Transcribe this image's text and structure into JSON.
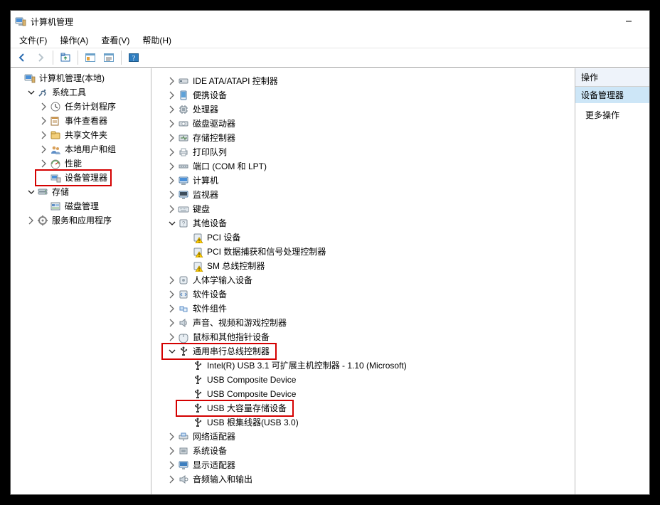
{
  "title": "计算机管理",
  "menus": {
    "file": "文件(F)",
    "action": "操作(A)",
    "view": "查看(V)",
    "help": "帮助(H)"
  },
  "right": {
    "header": "操作",
    "selected": "设备管理器",
    "more": "更多操作"
  },
  "left_tree": [
    {
      "depth": 0,
      "exp": "none",
      "icon": "mmc",
      "label": "计算机管理(本地)"
    },
    {
      "depth": 1,
      "exp": "open",
      "icon": "tools",
      "label": "系统工具"
    },
    {
      "depth": 2,
      "exp": "closed",
      "icon": "sched",
      "label": "任务计划程序"
    },
    {
      "depth": 2,
      "exp": "closed",
      "icon": "eventvwr",
      "label": "事件查看器"
    },
    {
      "depth": 2,
      "exp": "closed",
      "icon": "shares",
      "label": "共享文件夹"
    },
    {
      "depth": 2,
      "exp": "closed",
      "icon": "users",
      "label": "本地用户和组"
    },
    {
      "depth": 2,
      "exp": "closed",
      "icon": "perf",
      "label": "性能"
    },
    {
      "depth": 2,
      "exp": "none",
      "icon": "devmgr",
      "label": "设备管理器",
      "highlight": true
    },
    {
      "depth": 1,
      "exp": "open",
      "icon": "storage",
      "label": "存储"
    },
    {
      "depth": 2,
      "exp": "none",
      "icon": "diskmgr",
      "label": "磁盘管理"
    },
    {
      "depth": 1,
      "exp": "closed",
      "icon": "services",
      "label": "服务和应用程序"
    }
  ],
  "mid_tree": [
    {
      "depth": 0,
      "exp": "closed",
      "icon": "ide",
      "label": "IDE ATA/ATAPI 控制器"
    },
    {
      "depth": 0,
      "exp": "closed",
      "icon": "portable",
      "label": "便携设备"
    },
    {
      "depth": 0,
      "exp": "closed",
      "icon": "cpu",
      "label": "处理器"
    },
    {
      "depth": 0,
      "exp": "closed",
      "icon": "optical",
      "label": "磁盘驱动器"
    },
    {
      "depth": 0,
      "exp": "closed",
      "icon": "storctl",
      "label": "存储控制器"
    },
    {
      "depth": 0,
      "exp": "closed",
      "icon": "printer",
      "label": "打印队列"
    },
    {
      "depth": 0,
      "exp": "closed",
      "icon": "ports",
      "label": "端口 (COM 和 LPT)"
    },
    {
      "depth": 0,
      "exp": "closed",
      "icon": "computer",
      "label": "计算机"
    },
    {
      "depth": 0,
      "exp": "closed",
      "icon": "monitor",
      "label": "监视器"
    },
    {
      "depth": 0,
      "exp": "closed",
      "icon": "keyboard",
      "label": "键盘"
    },
    {
      "depth": 0,
      "exp": "open",
      "icon": "other",
      "label": "其他设备"
    },
    {
      "depth": 1,
      "exp": "none",
      "icon": "warn",
      "label": "PCI 设备"
    },
    {
      "depth": 1,
      "exp": "none",
      "icon": "warn",
      "label": "PCI 数据捕获和信号处理控制器"
    },
    {
      "depth": 1,
      "exp": "none",
      "icon": "warn",
      "label": "SM 总线控制器"
    },
    {
      "depth": 0,
      "exp": "closed",
      "icon": "hid",
      "label": "人体学输入设备"
    },
    {
      "depth": 0,
      "exp": "closed",
      "icon": "swdev",
      "label": "软件设备"
    },
    {
      "depth": 0,
      "exp": "closed",
      "icon": "swcomp",
      "label": "软件组件"
    },
    {
      "depth": 0,
      "exp": "closed",
      "icon": "audio",
      "label": "声音、视频和游戏控制器"
    },
    {
      "depth": 0,
      "exp": "closed",
      "icon": "mouse",
      "label": "鼠标和其他指针设备"
    },
    {
      "depth": 0,
      "exp": "open",
      "icon": "usb",
      "label": "通用串行总线控制器",
      "highlight": true
    },
    {
      "depth": 1,
      "exp": "none",
      "icon": "usb",
      "label": "Intel(R) USB 3.1 可扩展主机控制器 - 1.10 (Microsoft)"
    },
    {
      "depth": 1,
      "exp": "none",
      "icon": "usb",
      "label": "USB Composite Device"
    },
    {
      "depth": 1,
      "exp": "none",
      "icon": "usb",
      "label": "USB Composite Device"
    },
    {
      "depth": 1,
      "exp": "none",
      "icon": "usb",
      "label": "USB 大容量存储设备",
      "highlight": true
    },
    {
      "depth": 1,
      "exp": "none",
      "icon": "usb",
      "label": "USB 根集线器(USB 3.0)"
    },
    {
      "depth": 0,
      "exp": "closed",
      "icon": "network",
      "label": "网络适配器"
    },
    {
      "depth": 0,
      "exp": "closed",
      "icon": "system",
      "label": "系统设备"
    },
    {
      "depth": 0,
      "exp": "closed",
      "icon": "display",
      "label": "显示适配器"
    },
    {
      "depth": 0,
      "exp": "closed",
      "icon": "audioin",
      "label": "音频输入和输出"
    }
  ]
}
